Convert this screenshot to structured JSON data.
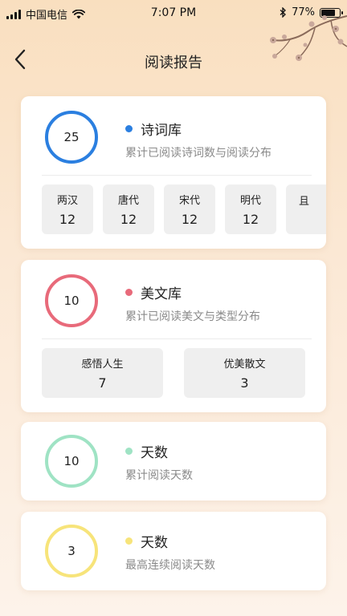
{
  "status_bar": {
    "carrier": "中国电信",
    "time": "7:07 PM",
    "battery": "77%",
    "battery_level": 0.77,
    "icons": [
      "signal-icon",
      "wifi-icon",
      "bluetooth-icon",
      "battery-icon"
    ]
  },
  "nav": {
    "title": "阅读报告",
    "back_icon": "chevron-left-icon"
  },
  "cards": {
    "poetry": {
      "count": "25",
      "title": "诗词库",
      "subtitle": "累计已阅读诗词数与阅读分布",
      "color": "#2b7fe0",
      "dynasties": [
        {
          "label": "两汉",
          "value": "12"
        },
        {
          "label": "唐代",
          "value": "12"
        },
        {
          "label": "宋代",
          "value": "12"
        },
        {
          "label": "明代",
          "value": "12"
        },
        {
          "label": "且",
          "value": ""
        }
      ]
    },
    "prose": {
      "count": "10",
      "title": "美文库",
      "subtitle": "累计已阅读美文与类型分布",
      "color": "#e86a7a",
      "types": [
        {
          "label": "感悟人生",
          "value": "7"
        },
        {
          "label": "优美散文",
          "value": "3"
        }
      ]
    },
    "days": {
      "count": "10",
      "title": "天数",
      "subtitle": "累计阅读天数",
      "color": "#9fe3c4"
    },
    "streak": {
      "count": "3",
      "title": "天数",
      "subtitle": "最高连续阅读天数",
      "color": "#f7e47a"
    }
  }
}
